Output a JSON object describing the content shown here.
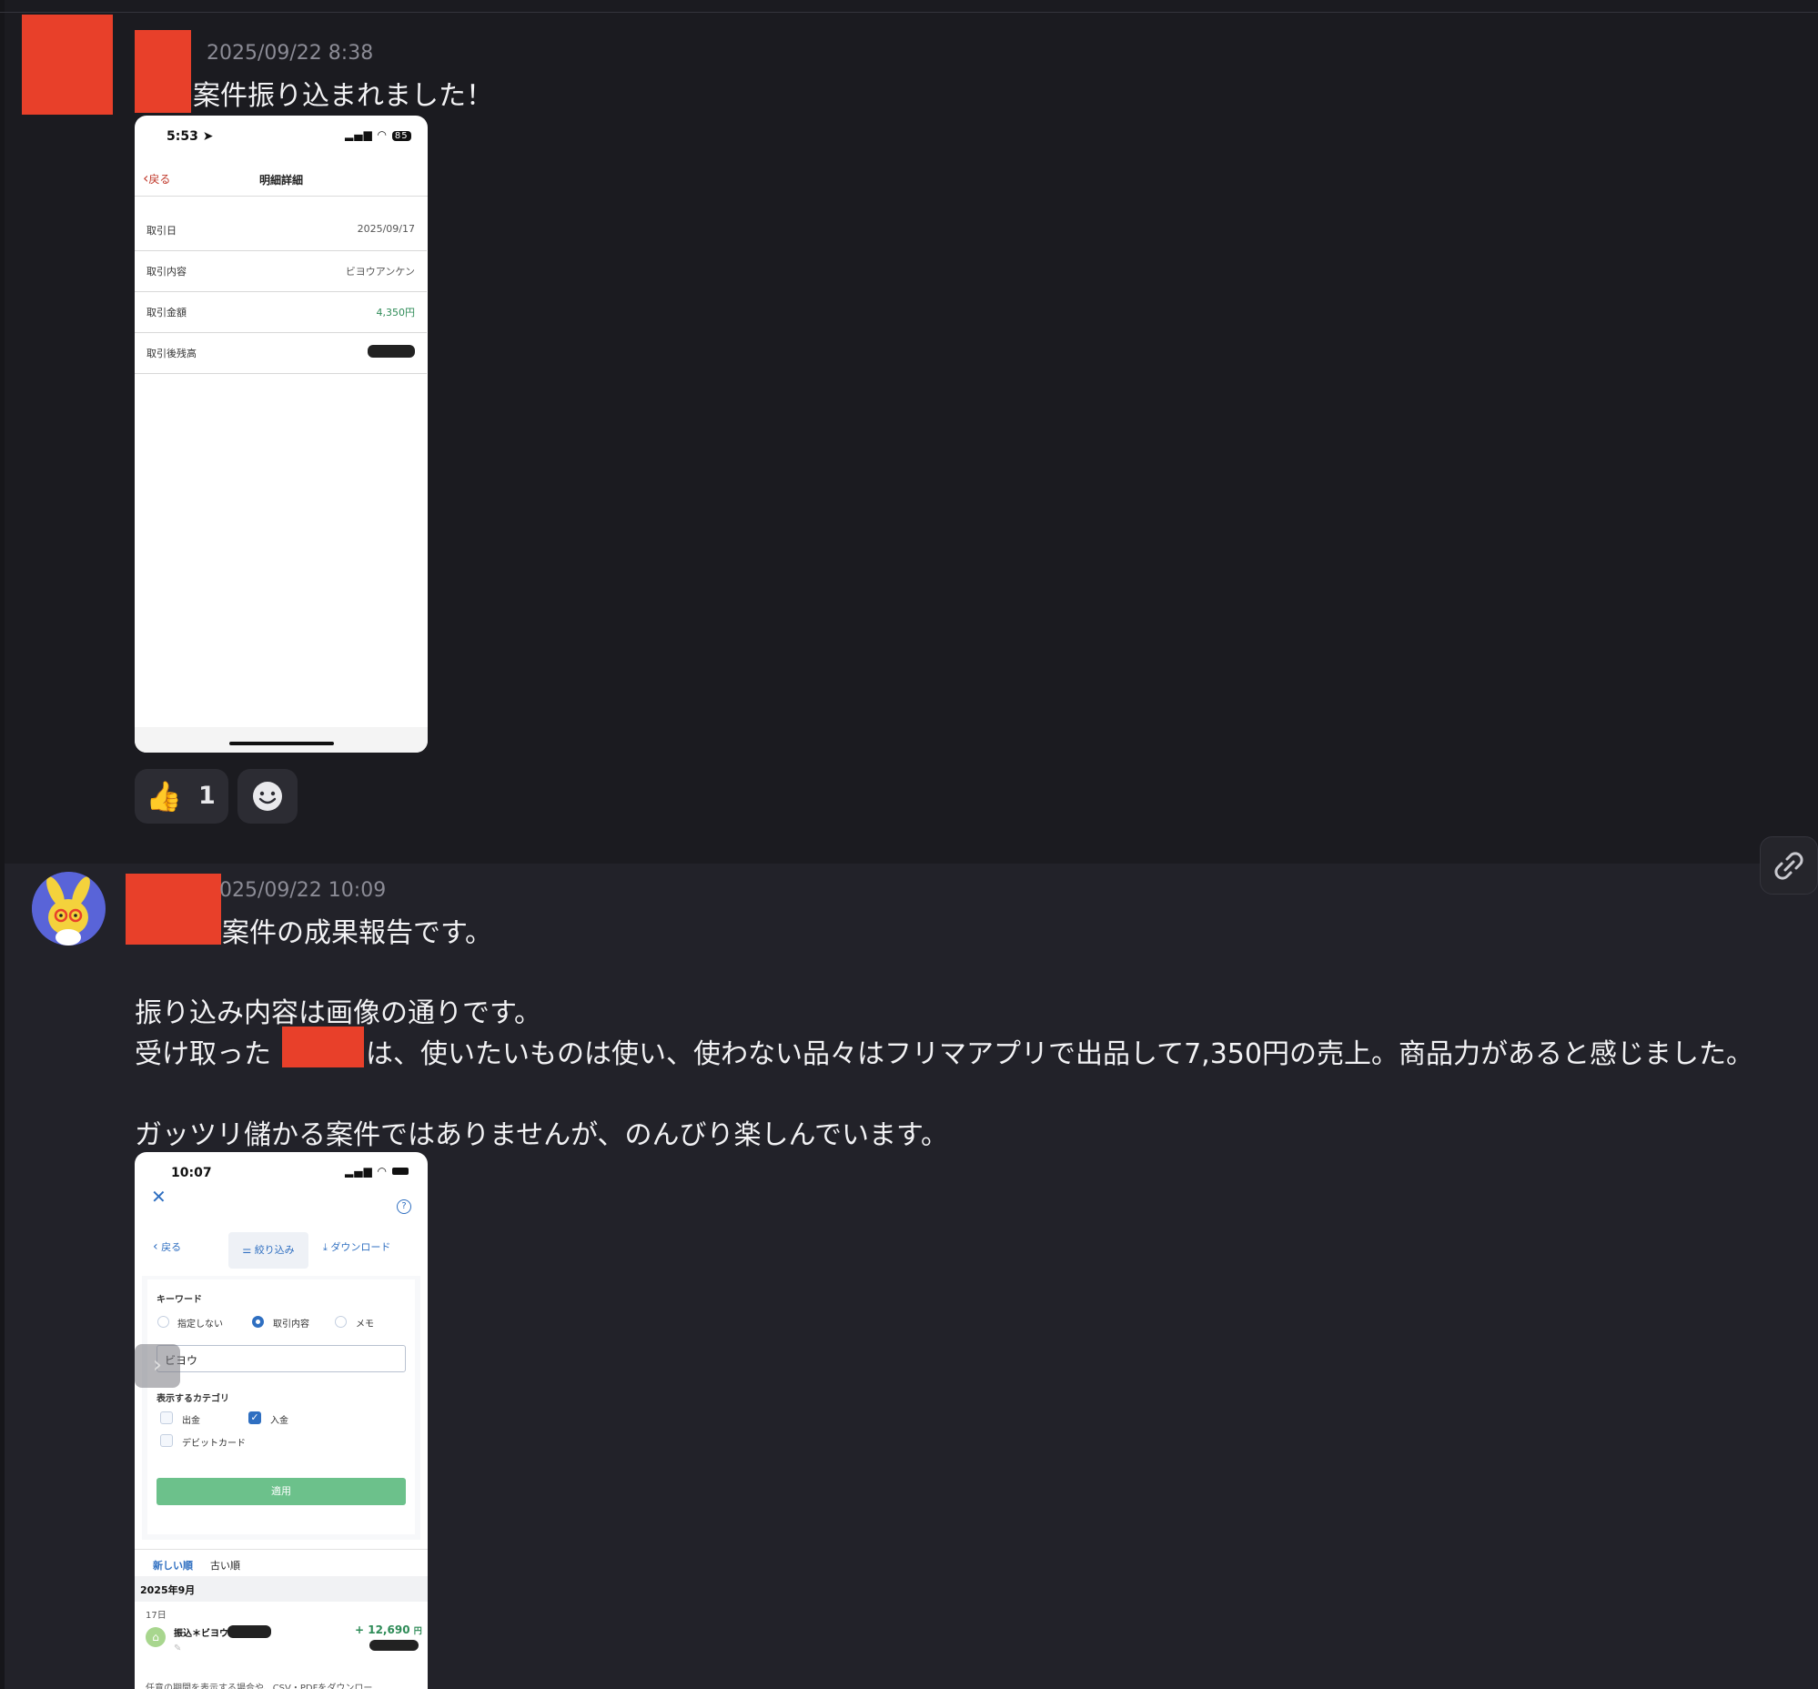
{
  "messages": [
    {
      "timestamp": "2025/09/22 8:38",
      "text": "案件振り込まれました！",
      "attachment": {
        "status_time": "5:53",
        "battery": "85",
        "back_label": "戻る",
        "title": "明細詳細",
        "rows": [
          {
            "label": "取引日",
            "value": "2025/09/17"
          },
          {
            "label": "取引内容",
            "value": "ビヨウアンケン"
          },
          {
            "label": "取引金額",
            "value": "4,350円"
          },
          {
            "label": "取引後残高",
            "value": ""
          }
        ]
      },
      "reactions": [
        {
          "emoji": "👍",
          "count": "1"
        }
      ]
    },
    {
      "timestamp": "025/09/22 10:09",
      "lines": [
        "案件の成果報告です。",
        "",
        "振り込み内容は画像の通りです。",
        "受け取った",
        "は、使いたいものは使い、使わない品々はフリマアプリで出品して7,350円の売上。商品力があると感じました。",
        "",
        "ガッツリ儲かる案件ではありませんが、のんびり楽しんでいます。"
      ],
      "attachment": {
        "status_time": "10:07",
        "back_label": "戻る",
        "filter_label": "絞り込み",
        "download_label": "ダウンロード",
        "keyword_label": "キーワード",
        "radio_options": [
          "指定しない",
          "取引内容",
          "メモ"
        ],
        "keyword_value": "ビヨウ",
        "category_label": "表示するカテゴリ",
        "categories": [
          {
            "label": "出金",
            "checked": false
          },
          {
            "label": "入金",
            "checked": true
          },
          {
            "label": "デビットカード",
            "checked": false
          }
        ],
        "apply_label": "適用",
        "sort_tabs": [
          "新しい順",
          "古い順"
        ],
        "month_header": "2025年9月",
        "day": "17日",
        "tx_name": "振込＊ビヨウアンケン",
        "tx_amount": "+ 12,690",
        "tx_unit": "円",
        "footer_text": "任意の期間を表示する場合や、CSV・PDFをダウンロー"
      }
    }
  ],
  "colors": {
    "redact": "#e8402a",
    "accent_green": "#6cc18b",
    "accent_blue": "#2f6fc1",
    "amount_green": "#2e8b57"
  }
}
